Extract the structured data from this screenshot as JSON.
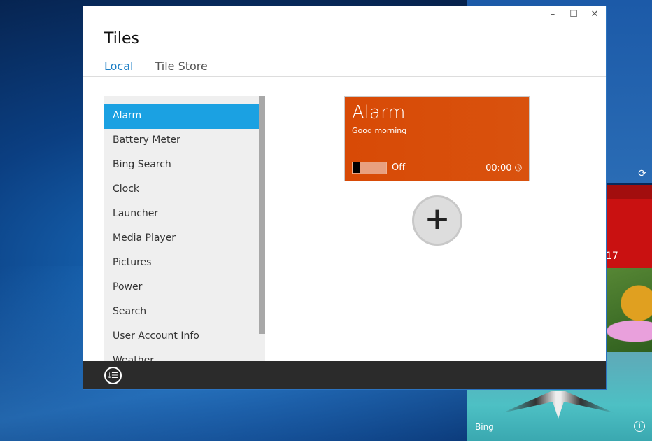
{
  "window": {
    "title": "Tiles",
    "controls": {
      "minimize": "–",
      "maximize": "☐",
      "close": "✕"
    }
  },
  "tabs": [
    {
      "label": "Local",
      "active": true
    },
    {
      "label": "Tile Store",
      "active": false
    }
  ],
  "list": {
    "items": [
      "Alarm",
      "Battery Meter",
      "Bing Search",
      "Clock",
      "Launcher",
      "Media Player",
      "Pictures",
      "Power",
      "Search",
      "User Account Info",
      "Weather"
    ],
    "selected": "Alarm"
  },
  "preview": {
    "title": "Alarm",
    "subtitle": "Good morning",
    "toggle_label": "Off",
    "toggle_on": false,
    "time": "00:00",
    "color": "#d84a06"
  },
  "add_button": "+",
  "bottom_bar": {
    "icon": "sort-list-icon"
  },
  "background_tiles": {
    "red_tile_text": "17",
    "photo_label": "Bing",
    "sync_icon": "⟳",
    "info_icon": "i"
  }
}
